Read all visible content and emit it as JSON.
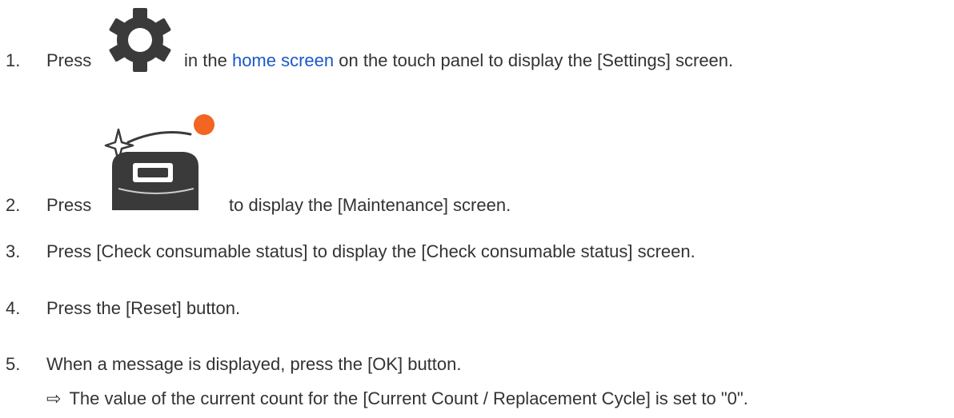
{
  "steps": [
    {
      "num": "1.",
      "before": "Press",
      "link": "home screen",
      "middle": "in the",
      "after": "on the touch panel to display the [Settings] screen.",
      "icon": "gear-icon"
    },
    {
      "num": "2.",
      "before": "Press",
      "after": "to display the [Maintenance] screen.",
      "icon": "maintenance-icon"
    },
    {
      "num": "3.",
      "text": "Press [Check consumable status] to display the [Check consumable status] screen."
    },
    {
      "num": "4.",
      "text": "Press the [Reset] button."
    },
    {
      "num": "5.",
      "text": "When a message is displayed, press the [OK] button."
    }
  ],
  "result": {
    "arrow": "⇨",
    "text": "The value of the current count for the [Current Count / Replacement Cycle] is set to \"0\"."
  },
  "colors": {
    "text": "#333333",
    "link": "#1a58c7",
    "icon_dark": "#3a3a3a",
    "badge": "#f26522"
  }
}
